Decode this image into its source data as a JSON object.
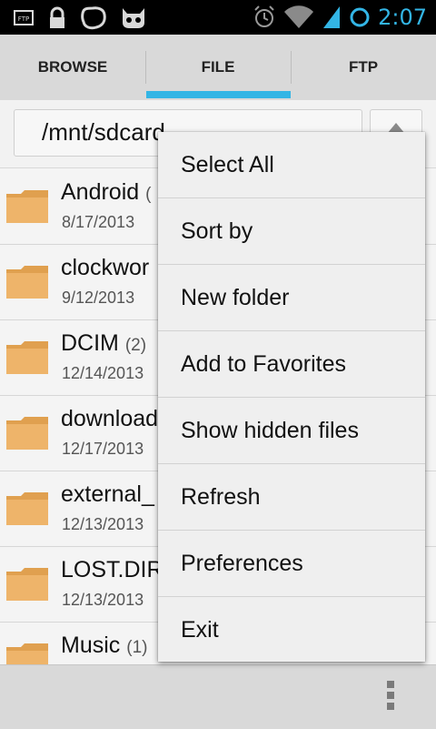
{
  "status_bar": {
    "time": "2:07",
    "left_icons": [
      "ftp-icon",
      "lock-icon",
      "blob-icon",
      "cyanogen-icon"
    ],
    "right_icons": [
      "alarm-icon",
      "wifi-icon",
      "signal-icon",
      "battery-ring-icon"
    ],
    "accent_color": "#33b5e5"
  },
  "tabs": [
    {
      "label": "BROWSE",
      "selected": false
    },
    {
      "label": "FILE",
      "selected": true
    },
    {
      "label": "FTP",
      "selected": false
    }
  ],
  "path": {
    "value": "/mnt/sdcard"
  },
  "files": [
    {
      "name": "Android",
      "count": "(",
      "date": "8/17/2013"
    },
    {
      "name": "clockwor",
      "count": "",
      "date": "9/12/2013"
    },
    {
      "name": "DCIM",
      "count": "(2)",
      "date": "12/14/2013"
    },
    {
      "name": "download",
      "count": "",
      "date": "12/17/2013"
    },
    {
      "name": "external_",
      "count": "",
      "date": "12/13/2013"
    },
    {
      "name": "LOST.DIR",
      "count": "",
      "date": "12/13/2013"
    },
    {
      "name": "Music",
      "count": "(1)",
      "date": ""
    }
  ],
  "menu": {
    "items": [
      {
        "label": "Select All"
      },
      {
        "label": "Sort by"
      },
      {
        "label": "New folder"
      },
      {
        "label": "Add to Favorites"
      },
      {
        "label": "Show hidden files"
      },
      {
        "label": "Refresh"
      },
      {
        "label": "Preferences"
      },
      {
        "label": "Exit"
      }
    ]
  },
  "colors": {
    "folder": "#e9a95a",
    "tab_indicator": "#33b5e5"
  }
}
